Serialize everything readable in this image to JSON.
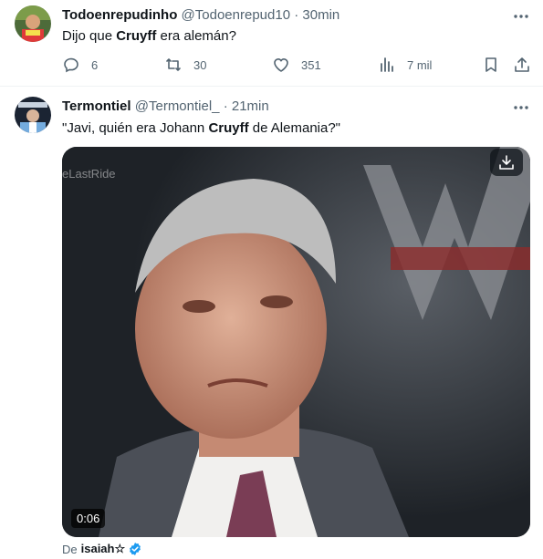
{
  "tweet1": {
    "name": "Todoenrepudinho",
    "handle": "@Todoenrepud10",
    "separator": "·",
    "time": "30min",
    "text_before": "Dijo que ",
    "text_keyword": "Cruyff",
    "text_after": " era alemán?",
    "actions": {
      "reply_count": "6",
      "repost_count": "30",
      "like_count": "351",
      "view_count": "7 mil"
    },
    "icons": [
      "more-icon",
      "reply-icon",
      "repost-icon",
      "like-icon",
      "views-icon",
      "bookmark-icon",
      "share-icon"
    ]
  },
  "tweet2": {
    "name": "Termontiel",
    "handle": "@Termontiel_",
    "separator": "·",
    "time": "21min",
    "text_before": "\"Javi, quién era Johann ",
    "text_keyword": "Cruyff",
    "text_after": " de Alemania?\"",
    "media": {
      "duration": "0:06",
      "watermark": "eLastRide",
      "icons": [
        "download-icon"
      ]
    },
    "from_prefix": "De",
    "from_source": "isaiah☆",
    "icons": [
      "more-icon",
      "verified-icon"
    ]
  },
  "colors": {
    "text_primary": "#0f1419",
    "text_secondary": "#536471",
    "verified": "#1d9bf0",
    "divider": "#eff3f4"
  }
}
